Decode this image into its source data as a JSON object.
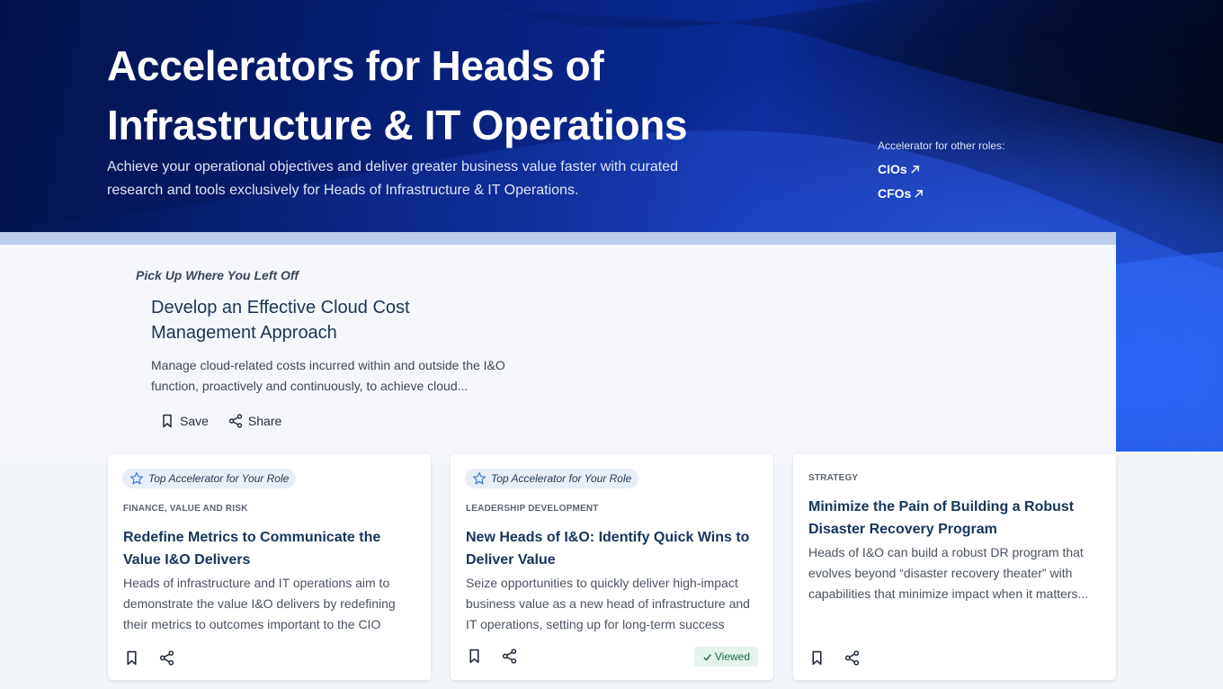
{
  "hero": {
    "title": "Accelerators for Heads of Infrastructure & IT Operations",
    "subtitle": "Achieve your operational objectives and deliver greater business value faster with curated research and tools exclusively for Heads of Infrastructure & IT Operations.",
    "other_roles_label": "Accelerator for other roles:",
    "other_roles": [
      "CIOs",
      "CFOs"
    ]
  },
  "resume": {
    "label": "Pick Up Where You Left Off",
    "title": "Develop an Effective Cloud Cost Management Approach",
    "description": "Manage cloud-related costs incurred within and outside the I&O function, proactively and continuously, to achieve cloud...",
    "save_label": "Save",
    "share_label": "Share"
  },
  "cards": [
    {
      "badge": "Top Accelerator for Your Role",
      "category": "FINANCE, VALUE AND RISK",
      "title": "Redefine Metrics to Communicate the Value I&O Delivers",
      "description": "Heads of infrastructure and IT operations aim to demonstrate the value I&O delivers by redefining their metrics to outcomes important to the CIO"
    },
    {
      "badge": "Top Accelerator for Your Role",
      "category": "LEADERSHIP DEVELOPMENT",
      "title": "New Heads of I&O: Identify Quick Wins to Deliver Value",
      "description": "Seize opportunities to quickly deliver high-impact business value as a new head of infrastructure and IT operations, setting up for long-term success",
      "status": "Viewed"
    },
    {
      "category": "STRATEGY",
      "title": "Minimize the Pain of Building a Robust Disaster Recovery Program",
      "description": "Heads of I&O can build a robust DR program that evolves beyond “disaster recovery theater” with capabilities that minimize impact when it matters..."
    }
  ],
  "colors": {
    "accent_title": "#17355a",
    "hero_blue": "#0a2a96",
    "viewed_green": "#1e6e48"
  }
}
